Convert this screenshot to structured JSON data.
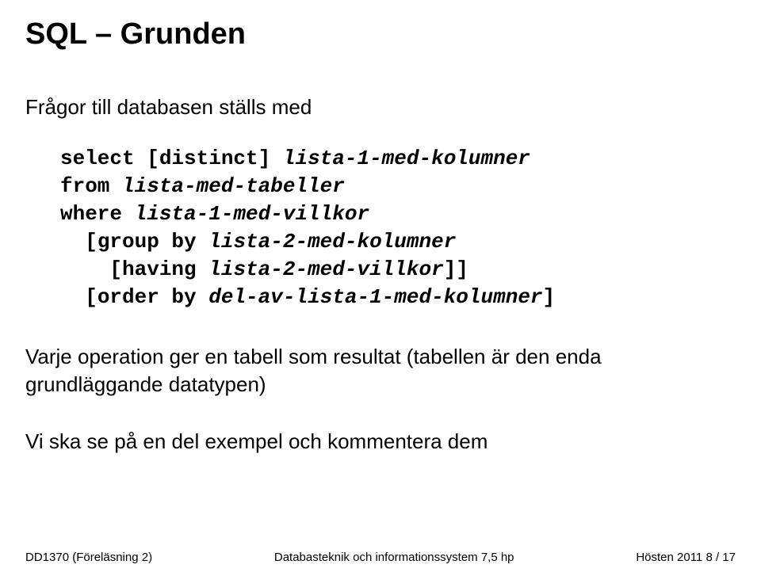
{
  "title": "SQL – Grunden",
  "lead": "Frågor till databasen ställs med",
  "code": {
    "l1_kw": "select [distinct] ",
    "l1_it": "lista-1-med-kolumner",
    "l2_kw": "from ",
    "l2_it": "lista-med-tabeller",
    "l3_kw": "where ",
    "l3_it": "lista-1-med-villkor",
    "l4_kw1": "[group by ",
    "l4_it1": "lista-2-med-kolumner",
    "l5_kw1": "[having ",
    "l5_it1": "lista-2-med-villkor",
    "l5_kw2": "]]",
    "l6_kw1": "[order by ",
    "l6_it1": "del-av-lista-1-med-kolumner",
    "l6_kw2": "]"
  },
  "para1": "Varje operation ger en tabell som resultat (tabellen är den enda grundläggande datatypen)",
  "para2": "Vi ska se på en del exempel och kommentera dem",
  "footer": {
    "left": "DD1370 (Föreläsning 2)",
    "center": "Databasteknik och informationssystem 7,5 hp",
    "right": "Hösten 2011    8 / 17"
  }
}
